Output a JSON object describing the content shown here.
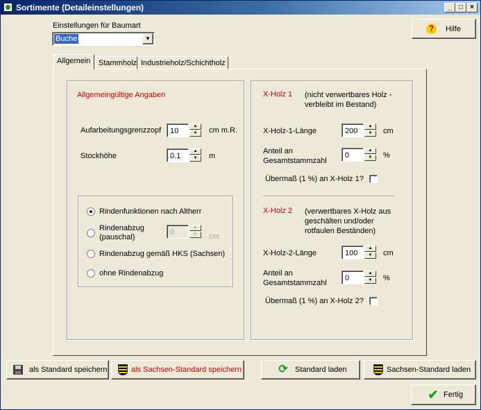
{
  "window": {
    "title": "Sortimente (Detaileinstellungen)"
  },
  "colors": {
    "title_start": "#0a246a",
    "title_end": "#a6caf0",
    "face": "#ece9d8",
    "accent_red": "#c00000"
  },
  "header": {
    "baumart_label": "Einstellungen für Baumart",
    "baumart_value": "Buche",
    "help_label": "Hilfe"
  },
  "tabs": [
    {
      "label": "Allgemein"
    },
    {
      "label": "Stammholz"
    },
    {
      "label": "Industrieholz/Schichtholz"
    }
  ],
  "general": {
    "heading": "Allgemeingültige Angaben",
    "grenzzopf_label": "Aufarbeitungsgrenzzopf",
    "grenzzopf_value": "10",
    "grenzzopf_unit": "cm m.R.",
    "stockhoehe_label": "Stockhöhe",
    "stockhoehe_value": "0.1",
    "stockhoehe_unit": "m"
  },
  "bark": {
    "option1": "Rindenfunktionen nach Altherr",
    "option2_line1": "Rindenabzug",
    "option2_line2": "(pauschal)",
    "option2_value": "0",
    "option2_unit": "cm",
    "option3": "Rindenabzug gemäß HKS (Sachsen)",
    "option4": "ohne Rindenabzug",
    "selected": 1
  },
  "xholz1": {
    "title": "X-Holz 1",
    "desc_line1": "(nicht verwertbares Holz -",
    "desc_line2": "verbleibt im Bestand)",
    "length_label": "X-Holz-1-Länge",
    "length_value": "200",
    "length_unit": "cm",
    "share_line1": "Anteil an",
    "share_line2": "Gesamtstammzahl",
    "share_value": "0",
    "share_unit": "%",
    "excess_label": "Übermaß (1 %) an X-Holz 1?"
  },
  "xholz2": {
    "title": "X-Holz 2",
    "desc_line1": "(verwertbares X-Holz aus",
    "desc_line2": "geschälten und/oder",
    "desc_line3": "rotfaulen Beständen)",
    "length_label": "X-Holz-2-Länge",
    "length_value": "100",
    "length_unit": "cm",
    "share_line1": "Anteil an",
    "share_line2": "Gesamtstammzahl",
    "share_value": "0",
    "share_unit": "%",
    "excess_label": "Übermaß (1 %) an X-Holz 2?"
  },
  "footer": {
    "save_default": "als Standard speichern",
    "save_saxony": "als Sachsen-Standard speichern",
    "load_default": "Standard laden",
    "load_saxony": "Sachsen-Standard laden",
    "done": "Fertig"
  }
}
